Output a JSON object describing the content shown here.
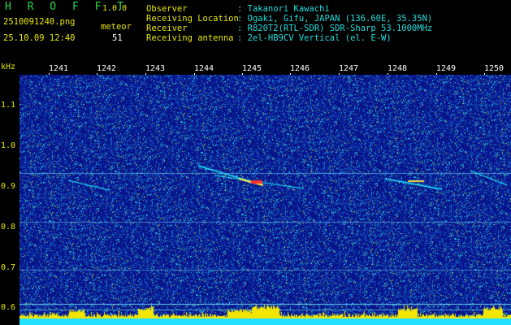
{
  "app": {
    "name": "H R O F F T",
    "version": "1.0.0",
    "filename": "2510091240.png",
    "datetime": "25.10.09 12:40",
    "counter_label": "meteor",
    "counter_value": "51"
  },
  "info": {
    "observer_label": "Observer",
    "observer_value": ": Takanori Kawachi",
    "location_label": "Receiving Location",
    "location_value": ": Ogaki, Gifu, JAPAN (136.60E, 35.35N)",
    "receiver_label": "Receiver",
    "receiver_value": ": R820T2(RTL-SDR) SDR-Sharp 53.1000MHz",
    "antenna_label": "Receiving antenna",
    "antenna_value": ": 2el-HB9CV Vertical (el. E-W)"
  },
  "axis": {
    "y_unit": "kHz",
    "y_ticks": [
      "1.1",
      "1.0",
      "0.9",
      "0.8",
      "0.7",
      "0.6"
    ],
    "x_ticks": [
      "1241",
      "1242",
      "1243",
      "1244",
      "1245",
      "1246",
      "1247",
      "1248",
      "1249",
      "1250"
    ]
  },
  "colors": {
    "background": "#000000",
    "spectrogram_base": "#0a1a8c",
    "title_green": "#2ed84a",
    "label_yellow": "#e8e800",
    "info_cyan": "#22dddd",
    "signal_cyan": "#22f0ff"
  }
}
